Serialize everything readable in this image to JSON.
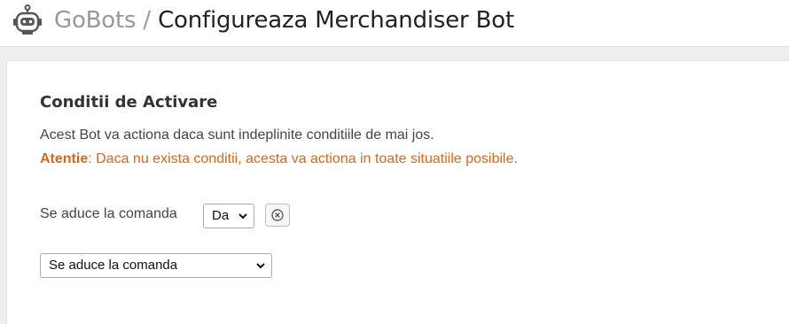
{
  "header": {
    "brand": "GoBots",
    "separator": "/",
    "page_title": "Configureaza Merchandiser Bot",
    "icon": "robot-icon"
  },
  "section": {
    "title": "Conditii de Activare",
    "description": "Acest Bot va actiona daca sunt indeplinite conditiile de mai jos.",
    "warning_label": "Atentie",
    "warning_text": ": Daca nu exista conditii, acesta va actiona in toate situatiile posibile."
  },
  "conditions": [
    {
      "label": "Se aduce la comanda",
      "selected_value": "Da",
      "remove_icon": "close-circle-icon"
    }
  ],
  "add_condition": {
    "selected_value": "Se aduce la comanda"
  },
  "colors": {
    "warning": "#d2691e",
    "brand_muted": "#999999"
  }
}
